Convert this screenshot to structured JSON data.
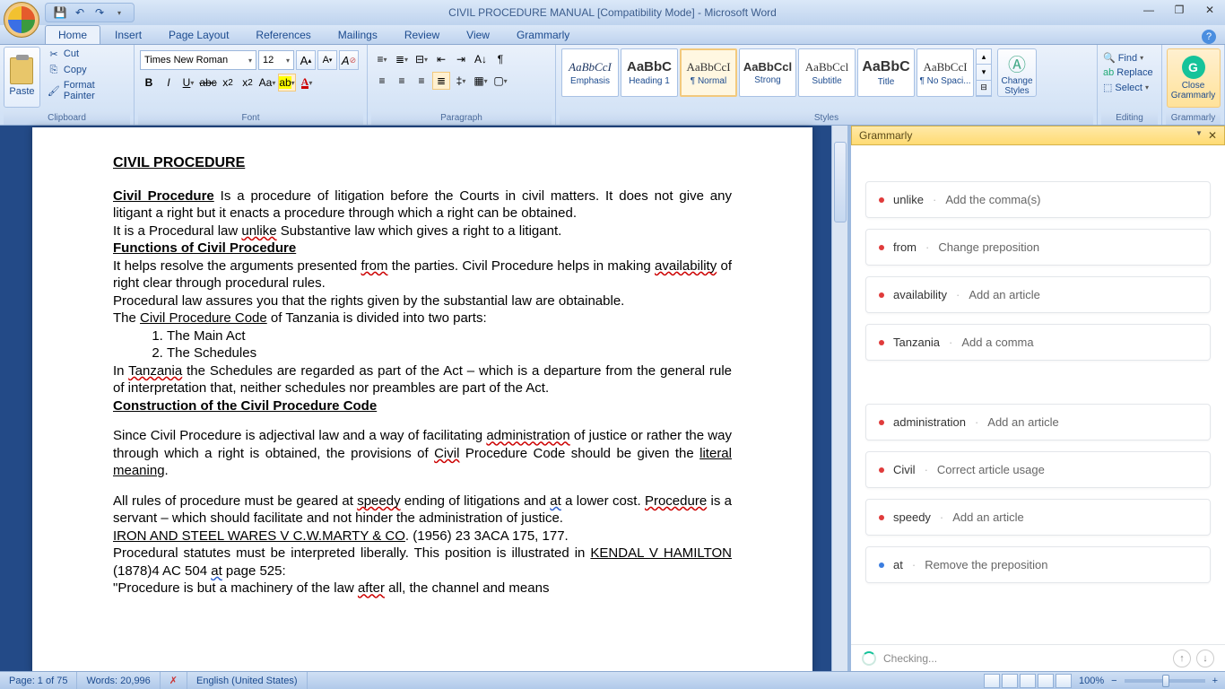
{
  "title": "CIVIL PROCEDURE MANUAL [Compatibility Mode] - Microsoft Word",
  "tabs": [
    "Home",
    "Insert",
    "Page Layout",
    "References",
    "Mailings",
    "Review",
    "View",
    "Grammarly"
  ],
  "ribbon": {
    "clipboard": {
      "label": "Clipboard",
      "paste": "Paste",
      "cut": "Cut",
      "copy": "Copy",
      "format_painter": "Format Painter"
    },
    "font": {
      "label": "Font",
      "name": "Times New Roman",
      "size": "12"
    },
    "paragraph": {
      "label": "Paragraph"
    },
    "styles": {
      "label": "Styles",
      "items": [
        {
          "preview": "AaBbCcI",
          "name": "Emphasis",
          "cls": "emph"
        },
        {
          "preview": "AaBbC",
          "name": "Heading 1",
          "cls": "h1"
        },
        {
          "preview": "AaBbCcI",
          "name": "¶ Normal",
          "cls": "normal"
        },
        {
          "preview": "AaBbCcl",
          "name": "Strong",
          "cls": "strong"
        },
        {
          "preview": "AaBbCcl",
          "name": "Subtitle",
          "cls": "normal"
        },
        {
          "preview": "AaBbC",
          "name": "Title",
          "cls": "title"
        },
        {
          "preview": "AaBbCcI",
          "name": "¶ No Spaci...",
          "cls": "normal"
        }
      ],
      "change": "Change Styles"
    },
    "editing": {
      "label": "Editing",
      "find": "Find",
      "replace": "Replace",
      "select": "Select"
    },
    "grammarly": {
      "label": "Grammarly",
      "close": "Close Grammarly"
    }
  },
  "doc": {
    "title": "CIVIL PROCEDURE",
    "p1_lead": "Civil Procedure",
    "p1_rest": " Is a procedure of litigation before the Courts in civil matters. It does not give any litigant a right but it enacts a procedure through which a right can be obtained.",
    "p2_a": "It is a Procedural law ",
    "p2_w": "unlike",
    "p2_b": " Substantive law which gives a right to a litigant.",
    "h2": "Functions of Civil Procedure",
    "p3_a": "It helps resolve the arguments presented ",
    "p3_w1": "from",
    "p3_b": " the parties. Civil Procedure helps in making ",
    "p3_w2": "availability",
    "p3_c": " of right clear through procedural rules.",
    "p4": "Procedural law assures you that the rights given by the substantial law are obtainable.",
    "p5_a": "The ",
    "p5_u": "Civil Procedure Code",
    "p5_b": " of Tanzania is divided into two parts:",
    "li1": "The Main Act",
    "li2": "The Schedules",
    "p6_a": "In ",
    "p6_w": "Tanzania",
    "p6_b": " the Schedules are regarded as part of the Act – which is a departure from the general rule of interpretation that, neither schedules nor preambles are part of the Act.",
    "h3": "Construction of the Civil Procedure Code",
    "p7_a": "Since Civil Procedure is adjectival law and a way of facilitating ",
    "p7_w1": "administration",
    "p7_b": " of justice or rather the way through which a right is obtained, the provisions of ",
    "p7_w2": "Civil",
    "p7_c": " Procedure Code should be given the ",
    "p7_u": "literal meaning",
    "p7_d": ".",
    "p8_a": "All rules of procedure must be geared at ",
    "p8_w1": "speedy",
    "p8_b": " ending of litigations and ",
    "p8_w2": "at",
    "p8_c": " a lower cost. ",
    "p8_w3": "Procedure",
    "p8_d": " is a servant – which should facilitate and not hinder the administration of justice.",
    "p9_u": "IRON AND STEEL WARES V C.W.MARTY & CO",
    "p9_b": ". (1956) 23 3ACA 175, 177.",
    "p10": "Procedural statutes must be interpreted liberally. This position is illustrated in ",
    "p10_u": "KENDAL V HAMILTON",
    "p10_b": " (1878)4 AC 504 ",
    "p10_w": "at",
    "p10_c": " page 525:",
    "p11_a": "\"Procedure is but a machinery of the law ",
    "p11_w": "after",
    "p11_b": " all, the channel and means"
  },
  "grammarly_panel": {
    "title": "Grammarly",
    "cards": [
      {
        "word": "unlike",
        "action": "Add the comma(s)",
        "dot": "red"
      },
      {
        "word": "from",
        "action": "Change preposition",
        "dot": "red"
      },
      {
        "word": "availability",
        "action": "Add an article",
        "dot": "red"
      },
      {
        "word": "Tanzania",
        "action": "Add a comma",
        "dot": "red"
      },
      {
        "word": "administration",
        "action": "Add an article",
        "dot": "red"
      },
      {
        "word": "Civil",
        "action": "Correct article usage",
        "dot": "red"
      },
      {
        "word": "speedy",
        "action": "Add an article",
        "dot": "red"
      },
      {
        "word": "at",
        "action": "Remove the preposition",
        "dot": "blue"
      }
    ],
    "status": "Checking..."
  },
  "statusbar": {
    "page": "Page: 1 of 75",
    "words": "Words: 20,996",
    "lang": "English (United States)",
    "zoom": "100%"
  }
}
